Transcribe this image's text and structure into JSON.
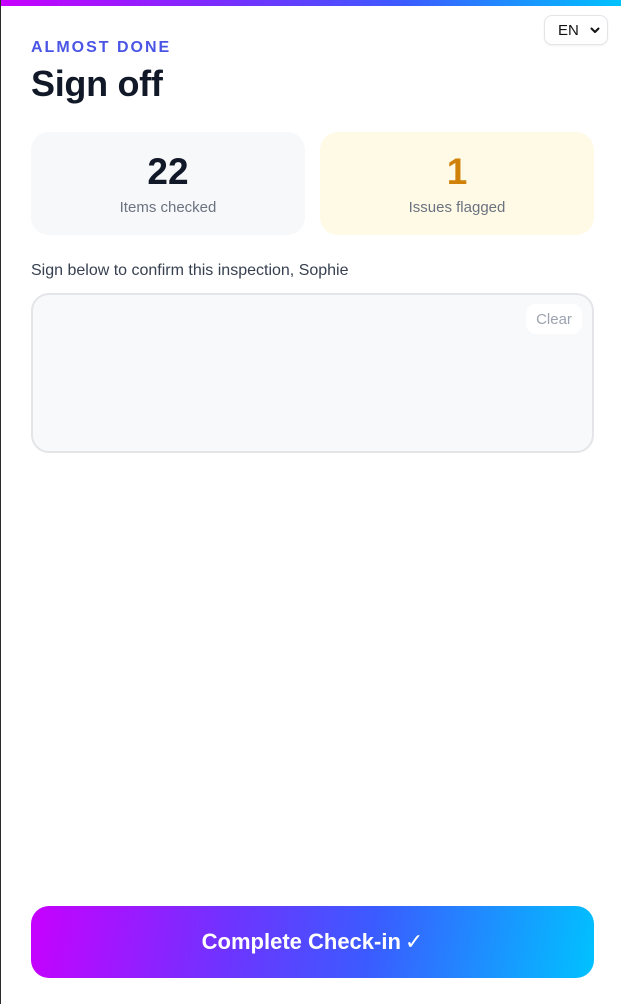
{
  "header": {
    "eyebrow": "ALMOST DONE",
    "title": "Sign off",
    "language": "EN"
  },
  "stats": {
    "checked": {
      "value": "22",
      "label": "Items checked"
    },
    "flagged": {
      "value": "1",
      "label": "Issues flagged"
    }
  },
  "signature": {
    "prompt": "Sign below to confirm this inspection, Sophie",
    "clear_label": "Clear"
  },
  "actions": {
    "complete_label": "Complete Check-in",
    "complete_glyph": "✓"
  },
  "colors": {
    "accent": "#4a55e6",
    "flag": "#d08108",
    "gradient_start": "#c800ff",
    "gradient_end": "#00c2ff"
  }
}
